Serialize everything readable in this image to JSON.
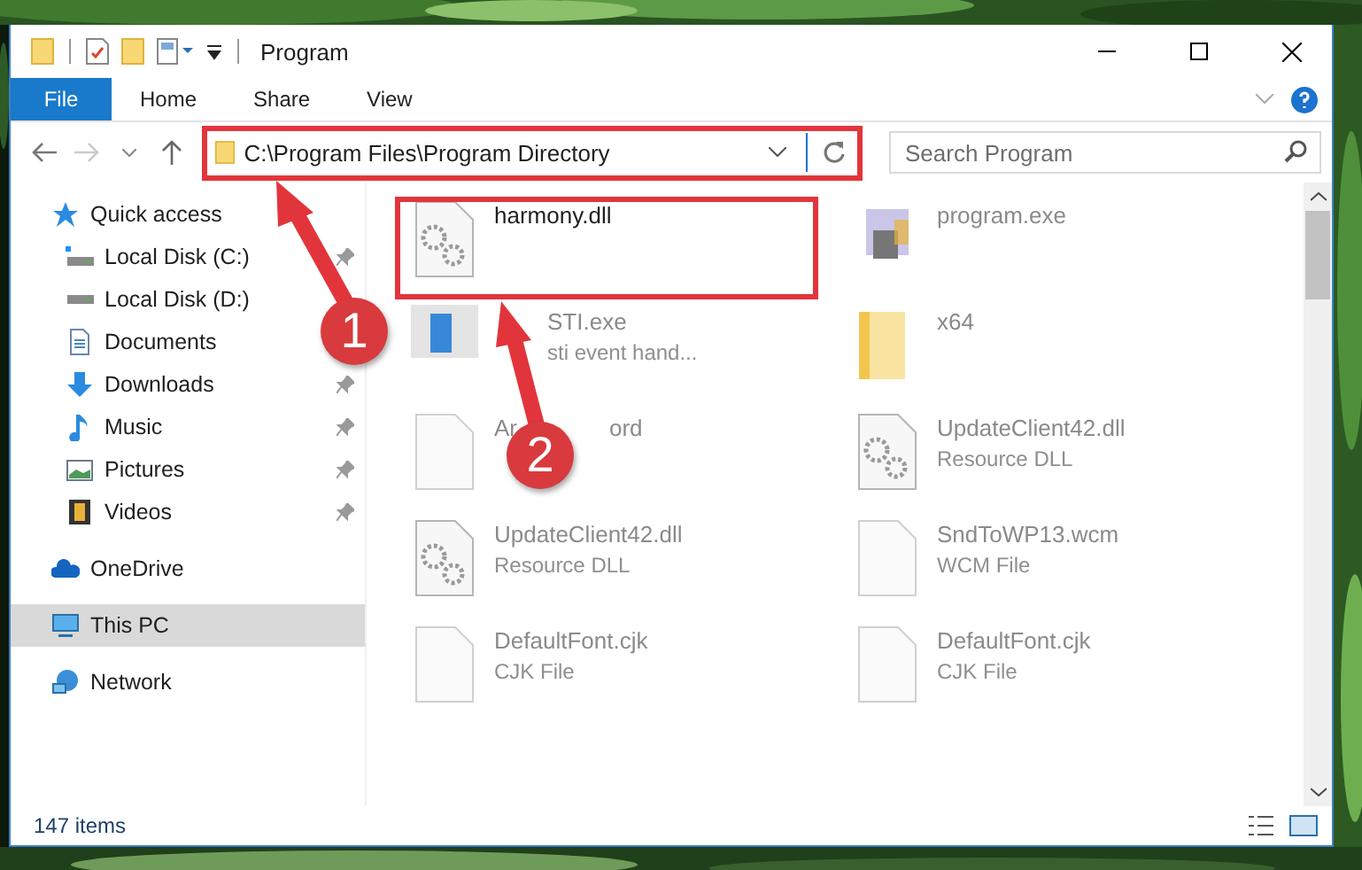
{
  "window": {
    "title": "Program"
  },
  "ribbon_tabs": [
    {
      "label": "File",
      "kind": "file"
    },
    {
      "label": "Home",
      "kind": "tab"
    },
    {
      "label": "Share",
      "kind": "tab"
    },
    {
      "label": "View",
      "kind": "tab"
    }
  ],
  "address": {
    "path": "C:\\Program Files\\Program Directory"
  },
  "search": {
    "placeholder": "Search Program"
  },
  "sidebar": {
    "items": [
      {
        "label": "Quick access",
        "kind": "star",
        "pinned": false,
        "selected": false,
        "children": [
          {
            "label": "Local Disk (C:)",
            "kind": "drive-system",
            "pinned": true,
            "selected": false
          },
          {
            "label": "Local Disk (D:)",
            "kind": "drive",
            "pinned": false,
            "selected": false
          },
          {
            "label": "Documents",
            "kind": "documents",
            "pinned": false,
            "selected": false
          },
          {
            "label": "Downloads",
            "kind": "downloads",
            "pinned": true,
            "selected": false
          },
          {
            "label": "Music",
            "kind": "music",
            "pinned": true,
            "selected": false
          },
          {
            "label": "Pictures",
            "kind": "pictures",
            "pinned": true,
            "selected": false
          },
          {
            "label": "Videos",
            "kind": "videos",
            "pinned": true,
            "selected": false
          }
        ]
      },
      {
        "label": "OneDrive",
        "kind": "cloud",
        "pinned": false,
        "selected": false
      },
      {
        "label": "This PC",
        "kind": "pc",
        "pinned": false,
        "selected": true
      },
      {
        "label": "Network",
        "kind": "network",
        "pinned": false,
        "selected": false
      }
    ]
  },
  "files": [
    {
      "name": "harmony.dll",
      "kind": "dll",
      "dimmed": false
    },
    {
      "name": "program.exe",
      "kind": "app",
      "dimmed": true
    },
    {
      "name": "STI.exe",
      "type": "sti event hand...",
      "kind": "exe",
      "dimmed": true
    },
    {
      "name": "x64",
      "kind": "folder",
      "dimmed": true
    },
    {
      "name": "Ar",
      "name_tail": "ord",
      "kind": "file",
      "dimmed": true
    },
    {
      "name": "UpdateClient42.dll",
      "type": "Resource DLL",
      "kind": "dll",
      "dimmed": true
    },
    {
      "name": "UpdateClient42.dll",
      "type": "Resource DLL",
      "kind": "dll",
      "dimmed": true
    },
    {
      "name": "SndToWP13.wcm",
      "type": "WCM File",
      "kind": "file",
      "dimmed": true
    },
    {
      "name": "DefaultFont.cjk",
      "type": "CJK File",
      "kind": "file",
      "dimmed": true
    },
    {
      "name": "DefaultFont.cjk",
      "type": "CJK File",
      "kind": "file",
      "dimmed": true
    }
  ],
  "status_bar": {
    "count": "147 items"
  },
  "annotations": [
    {
      "label": "1"
    },
    {
      "label": "2"
    }
  ]
}
